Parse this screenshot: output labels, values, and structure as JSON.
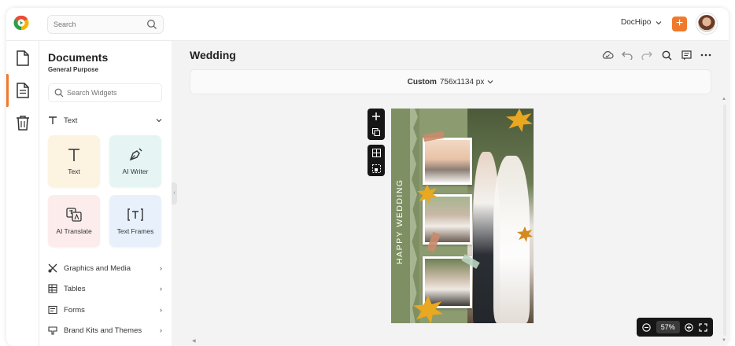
{
  "search": {
    "placeholder": "Search"
  },
  "account": {
    "name": "DocHipo"
  },
  "panel": {
    "title": "Documents",
    "subtitle": "General Purpose",
    "widget_search_placeholder": "Search Widgets",
    "text_section": "Text",
    "cards": [
      {
        "label": "Text",
        "bg": "#fdf3e1"
      },
      {
        "label": "AI Writer",
        "bg": "#e6f5f3"
      },
      {
        "label": "AI Translate",
        "bg": "#fdecec"
      },
      {
        "label": "Text Frames",
        "bg": "#e8f1fb"
      }
    ],
    "sections": [
      "Graphics and Media",
      "Tables",
      "Forms",
      "Brand Kits and Themes"
    ]
  },
  "document": {
    "title": "Wedding"
  },
  "size": {
    "label": "Custom",
    "value": "756x1134 px"
  },
  "canvas": {
    "vertical_text": "HAPPY WEDDING"
  },
  "zoom": {
    "value": "57%"
  },
  "colors": {
    "accent": "#f07a2b",
    "canvas_green": "#8c9c70",
    "leaf": "#e9a81f"
  }
}
